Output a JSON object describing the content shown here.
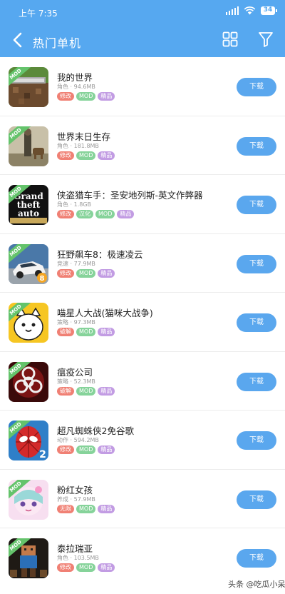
{
  "status_bar": {
    "time": "上午 7:35",
    "battery": "34"
  },
  "header": {
    "title": "热门单机"
  },
  "colors": {
    "accent": "#56a8f0",
    "tag_red": "#f08074",
    "tag_green": "#86d39a",
    "tag_purple": "#c29ce3"
  },
  "download_label": "下载",
  "apps": [
    {
      "name": "我的世界",
      "size": "角色 · 94.6MB",
      "tags": [
        {
          "text": "修改",
          "color": "#f08074"
        },
        {
          "text": "MOD",
          "color": "#86d39a"
        },
        {
          "text": "精品",
          "color": "#c29ce3"
        }
      ],
      "icon": "minecraft-icon"
    },
    {
      "name": "世界末日生存",
      "size": "角色 · 181.8MB",
      "tags": [
        {
          "text": "修改",
          "color": "#f08074"
        },
        {
          "text": "MOD",
          "color": "#86d39a"
        },
        {
          "text": "精品",
          "color": "#c29ce3"
        }
      ],
      "icon": "survival-icon"
    },
    {
      "name": "侠盗猎车手：圣安地列斯-英文作弊器",
      "size": "角色 · 1.8GB",
      "tags": [
        {
          "text": "修改",
          "color": "#f08074"
        },
        {
          "text": "汉化",
          "color": "#86d39a"
        },
        {
          "text": "MOD",
          "color": "#86d39a"
        },
        {
          "text": "精品",
          "color": "#c29ce3"
        }
      ],
      "icon": "gta-icon"
    },
    {
      "name": "狂野飙车8：极速凌云",
      "size": "竞速 · 77.9MB",
      "tags": [
        {
          "text": "修改",
          "color": "#f08074"
        },
        {
          "text": "MOD",
          "color": "#86d39a"
        },
        {
          "text": "精品",
          "color": "#c29ce3"
        }
      ],
      "icon": "racing-car-icon"
    },
    {
      "name": "喵星人大战(猫咪大战争)",
      "size": "策略 · 97.3MB",
      "tags": [
        {
          "text": "破解",
          "color": "#f08074"
        },
        {
          "text": "MOD",
          "color": "#86d39a"
        },
        {
          "text": "精品",
          "color": "#c29ce3"
        }
      ],
      "icon": "cat-icon"
    },
    {
      "name": "瘟疫公司",
      "size": "策略 · 52.3MB",
      "tags": [
        {
          "text": "破解",
          "color": "#f08074"
        },
        {
          "text": "MOD",
          "color": "#86d39a"
        },
        {
          "text": "精品",
          "color": "#c29ce3"
        }
      ],
      "icon": "biohazard-icon"
    },
    {
      "name": "超凡蜘蛛侠2免谷歌",
      "size": "动作 · 594.2MB",
      "tags": [
        {
          "text": "修改",
          "color": "#f08074"
        },
        {
          "text": "MOD",
          "color": "#86d39a"
        },
        {
          "text": "精品",
          "color": "#c29ce3"
        }
      ],
      "icon": "spiderman-icon"
    },
    {
      "name": "粉红女孩",
      "size": "养成 · 57.9MB",
      "tags": [
        {
          "text": "无限",
          "color": "#f08074"
        },
        {
          "text": "MOD",
          "color": "#86d39a"
        },
        {
          "text": "精品",
          "color": "#c29ce3"
        }
      ],
      "icon": "pink-girl-icon"
    },
    {
      "name": "泰拉瑞亚",
      "size": "角色 · 103.5MB",
      "tags": [
        {
          "text": "修改",
          "color": "#f08074"
        },
        {
          "text": "MOD",
          "color": "#86d39a"
        },
        {
          "text": "精品",
          "color": "#c29ce3"
        }
      ],
      "icon": "terraria-icon"
    }
  ],
  "ribbon_label": "MOD",
  "watermark": "头条 @吃瓜小呆"
}
